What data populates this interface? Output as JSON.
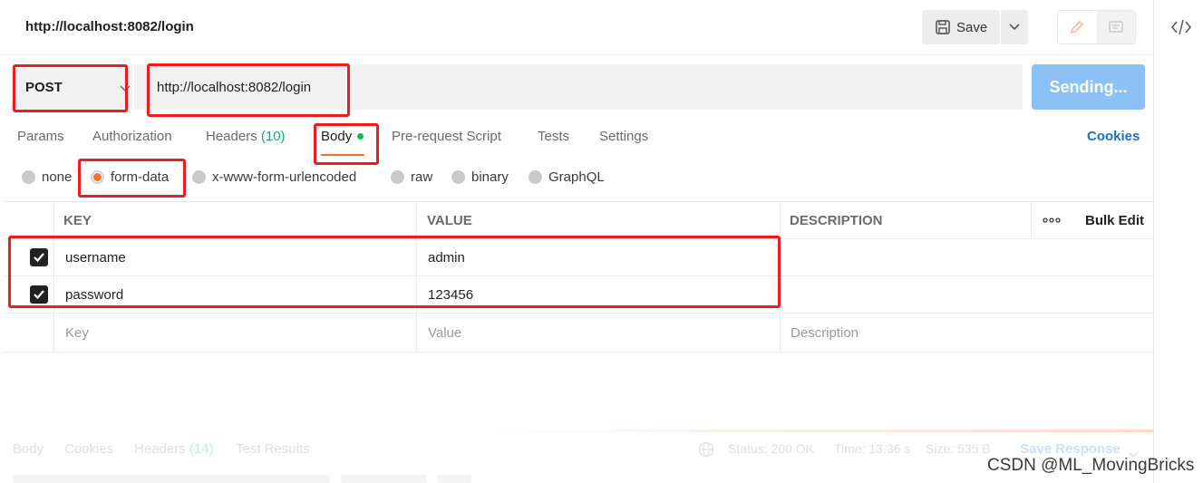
{
  "header": {
    "title": "http://localhost:8082/login",
    "save_label": "Save"
  },
  "request": {
    "method": "POST",
    "url": "http://localhost:8082/login",
    "send_label": "Sending..."
  },
  "tabs": {
    "params": "Params",
    "authorization": "Authorization",
    "headers": "Headers",
    "headers_count": "(10)",
    "body": "Body",
    "prerequest": "Pre-request Script",
    "tests": "Tests",
    "settings": "Settings",
    "cookies": "Cookies"
  },
  "body_types": {
    "none": "none",
    "form_data": "form-data",
    "urlencoded": "x-www-form-urlencoded",
    "raw": "raw",
    "binary": "binary",
    "graphql": "GraphQL",
    "selected": "form-data"
  },
  "table": {
    "headers": {
      "key": "KEY",
      "value": "VALUE",
      "description": "DESCRIPTION",
      "more": "ooo",
      "bulk_edit": "Bulk Edit"
    },
    "rows": [
      {
        "key": "username",
        "value": "admin",
        "checked": true
      },
      {
        "key": "password",
        "value": "123456",
        "checked": true
      }
    ],
    "placeholders": {
      "key": "Key",
      "value": "Value",
      "description": "Description"
    }
  },
  "response": {
    "body": "Body",
    "cookies": "Cookies",
    "headers": "Headers",
    "headers_count": "(14)",
    "test_results": "Test Results",
    "status": "Status: 200 OK",
    "time": "Time: 13.36 s",
    "size": "Size: 535 B",
    "save_response": "Save Response"
  },
  "watermark": "CSDN @ML_MovingBricks",
  "colors": {
    "accent": "#ff6c37",
    "send_button": "#8cc1f5",
    "link": "#1d6fc2",
    "annotation": "#ee1c1c",
    "status_dot": "#0cbb52"
  }
}
